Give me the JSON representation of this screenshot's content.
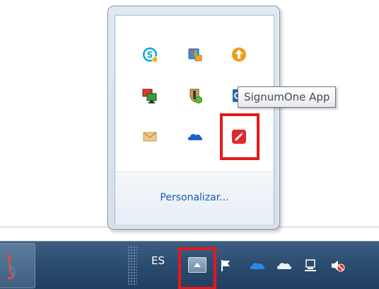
{
  "tooltip": {
    "text": "SignumOne App"
  },
  "flyout": {
    "customize_label": "Personalizar...",
    "icons": [
      {
        "name": "skype-icon",
        "color": "#00a8e6"
      },
      {
        "name": "windows-update-icon",
        "color": "#2f8fd6"
      },
      {
        "name": "upload-arrow-icon",
        "color": "#f39c1c"
      },
      {
        "name": "network-monitor-icon",
        "color": "#d93b2b"
      },
      {
        "name": "security-shield-icon",
        "color": "#caa14a"
      },
      {
        "name": "outlook-icon",
        "color": "#1f66b2"
      },
      {
        "name": "mail-icon",
        "color": "#e9c17c"
      },
      {
        "name": "onedrive-icon",
        "color": "#1e63c4"
      },
      {
        "name": "signumone-app-icon",
        "color": "#e02a2a"
      }
    ]
  },
  "taskbar": {
    "language": "ES",
    "tray_icons": [
      "action-center-flag-icon",
      "onedrive-blue-cloud-icon",
      "onedrive-white-cloud-icon",
      "network-icon",
      "volume-muted-icon"
    ]
  },
  "highlight_color": "#e3191c"
}
